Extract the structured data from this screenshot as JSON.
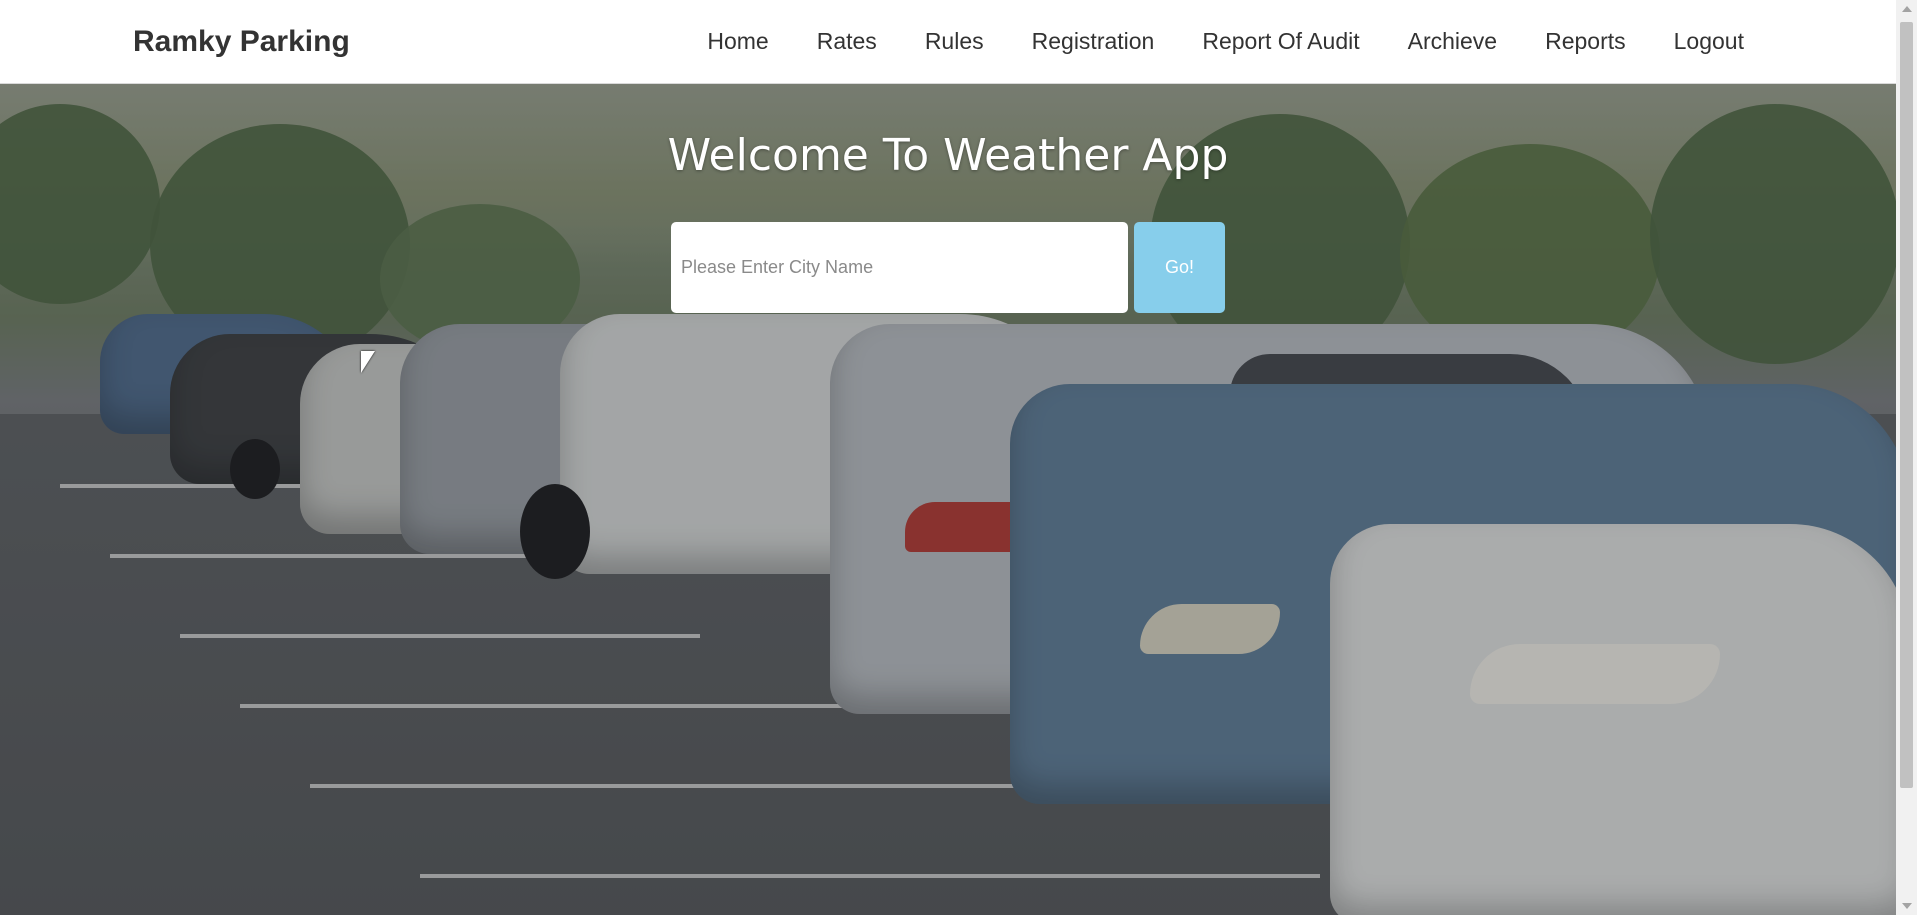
{
  "navbar": {
    "brand": "Ramky Parking",
    "links": [
      "Home",
      "Rates",
      "Rules",
      "Registration",
      "Report Of Audit",
      "Archieve",
      "Reports",
      "Logout"
    ]
  },
  "hero": {
    "title": "Welcome To Weather App",
    "search": {
      "placeholder": "Please Enter City Name",
      "value": "",
      "button_label": "Go!"
    }
  },
  "colors": {
    "button_bg": "#87ceeb",
    "brand_text": "#333333",
    "title_text": "#ffffff"
  },
  "icons": [
    "mouse-cursor-icon"
  ]
}
